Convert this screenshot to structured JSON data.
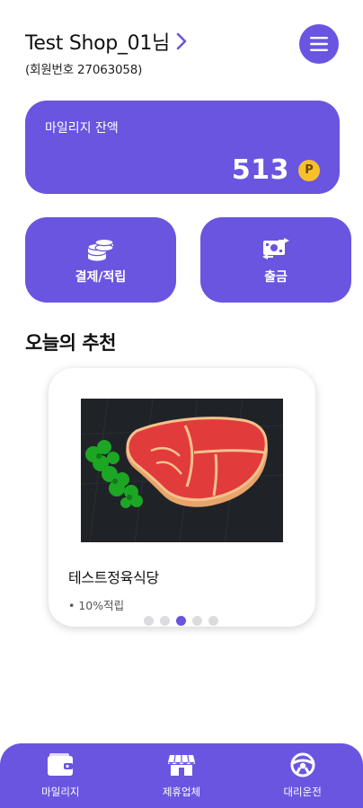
{
  "header": {
    "user_name": "Test Shop_01님",
    "member_id": "(회원번호 27063058)"
  },
  "balance": {
    "label": "마일리지 잔액",
    "value": "513",
    "currency_badge": "P"
  },
  "actions": [
    {
      "label": "결제/적립",
      "icon": "coins-icon"
    },
    {
      "label": "출금",
      "icon": "cash-transfer-icon"
    }
  ],
  "recommendation": {
    "title": "오늘의 추천",
    "item_name": "테스트정육식당",
    "item_tag": "• 10%적립",
    "page_count": 5,
    "active_page": 3
  },
  "bottom_nav": [
    {
      "label": "마일리지",
      "icon": "wallet-icon"
    },
    {
      "label": "제휴업체",
      "icon": "store-icon"
    },
    {
      "label": "대리운전",
      "icon": "steering-wheel-icon"
    }
  ],
  "colors": {
    "accent": "#6a55e0",
    "point_badge": "#f7c02c"
  }
}
